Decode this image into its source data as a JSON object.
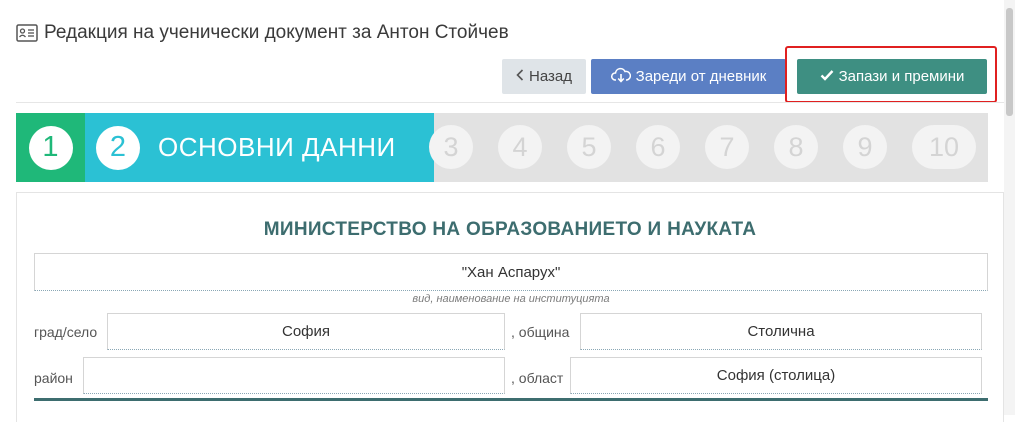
{
  "header": {
    "title": "Редакция на ученически документ за Антон Стойчев",
    "title_icon": "id-card-icon"
  },
  "toolbar": {
    "back_label": "Назад",
    "back_icon": "chevron-left-icon",
    "load_label": "Зареди от дневник",
    "load_icon": "cloud-download-icon",
    "save_label": "Запази и премини",
    "save_icon": "check-icon",
    "highlight_color": "#e02020"
  },
  "stepper": {
    "completed": "1",
    "active": {
      "number": "2",
      "label": "ОСНОВНИ ДАННИ"
    },
    "upcoming": [
      "3",
      "4",
      "5",
      "6",
      "7",
      "8",
      "9",
      "10"
    ],
    "colors": {
      "completed": "#1fb879",
      "active": "#2bc1d4",
      "inactive": "#e2e2e2"
    }
  },
  "document": {
    "ministry": "МИНИСТЕРСТВО НА ОБРАЗОВАНИЕТО И НАУКАТА",
    "institution": "\"Хан Аспарух\"",
    "institution_caption": "вид, наименование на институцията",
    "town_label": "град/село",
    "town_value": "София",
    "municipality_label": ", община",
    "municipality_value": "Столична",
    "district_label": "район",
    "district_value": "",
    "region_label": ", област",
    "region_value": "София (столица)"
  }
}
